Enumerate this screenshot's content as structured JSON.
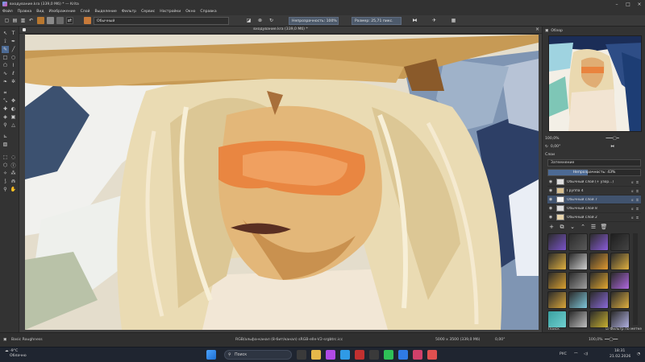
{
  "window": {
    "title": "входувание.kra (339,0 Мб) * — Krita"
  },
  "menu": [
    "Файл",
    "Правка",
    "Вид",
    "Изображение",
    "Слой",
    "Выделение",
    "Фильтр",
    "Сервис",
    "Настройки",
    "Окно",
    "Справка"
  ],
  "toolbar": {
    "blend_mode": "Обычный",
    "opacity_label": "Непрозрачность: 100%",
    "size_label": "Размер: 25,71 пикс."
  },
  "document": {
    "tab_title": "входувание.kra (339,0 Мб) *"
  },
  "overview": {
    "title": "Обзор",
    "zoom": "100,0%",
    "rotation": "0,00°"
  },
  "layers": {
    "title": "Слои",
    "blend_mode": "Затемнение",
    "opacity_label": "Непрозрачность: 43%",
    "opacity_fraction": 0.43,
    "items": [
      {
        "name": "Обычный слой (+ узор...)",
        "active": false
      },
      {
        "name": "Группа 4",
        "active": false
      },
      {
        "name": "Обычный слой 7",
        "active": true
      },
      {
        "name": "Обычный слой 8",
        "active": false
      },
      {
        "name": "Обычный слой 2",
        "active": false
      }
    ]
  },
  "brushes": {
    "filter_label": "Фильтр по метке",
    "search_label": "Поиск"
  },
  "status": {
    "brush_preset": "Basic Roughness",
    "color_info": "RGB/альфа-канал (8-бит/канал) sRGB-elle-V2-srgbtrc.icc",
    "dimensions": "5000 x 3500 (339,0 Мб)",
    "rotation": "0,00°",
    "zoom": "100,0%"
  },
  "taskbar": {
    "temperature": "-9°C",
    "weather": "Облачно",
    "search_label": "Поиск",
    "lang": "РУС",
    "time": "18:31",
    "date": "21.02.2026"
  },
  "colors": {
    "accent": "#4c6a94",
    "chrome_bg": "#333333"
  }
}
